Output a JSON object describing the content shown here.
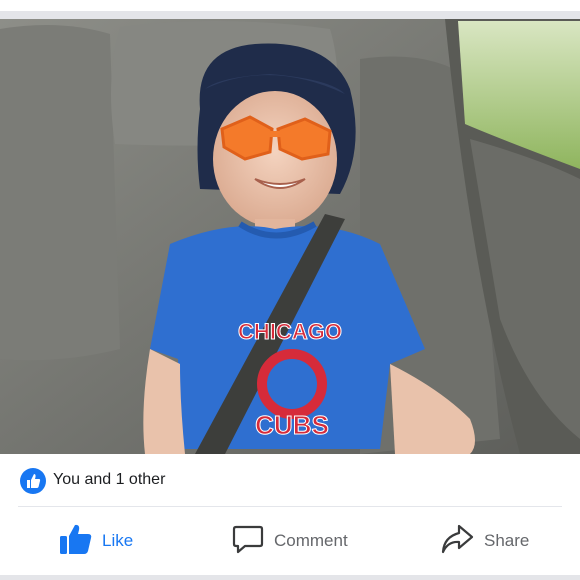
{
  "post": {
    "photo_alt": "",
    "shirt_text_top": "CHICAGO",
    "shirt_text_bottom": "CUBS"
  },
  "reactions": {
    "summary": "You and 1 other",
    "icon": "thumbs-up-icon",
    "color": "#1877f2"
  },
  "actions": {
    "like_label": "Like",
    "comment_label": "Comment",
    "share_label": "Share",
    "like_icon": "thumbs-up-icon",
    "comment_icon": "speech-bubble-icon",
    "share_icon": "share-arrow-icon",
    "active_color": "#1877f2",
    "inactive_color": "#65676b"
  }
}
